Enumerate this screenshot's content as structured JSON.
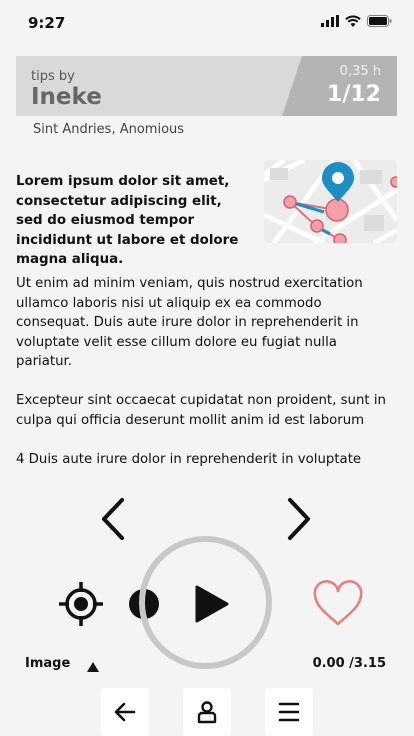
{
  "status_bar": {
    "time": "9:27"
  },
  "header": {
    "tips_by": "tips by",
    "guide_name": "Ineke",
    "duration": "0,35 h",
    "counter": "1/12"
  },
  "location": "Sint Andries, Anomious",
  "content": {
    "intro": "Lorem ipsum dolor sit amet, consectetur adipiscing elit, sed do eiusmod tempor incididunt ut labore et dolore magna aliqua.",
    "paragraphs": [
      "Ut enim ad minim veniam,  quis nostrud exercitation ullamco laboris nisi ut aliquip ex ea commodo consequat. Duis aute irure dolor in reprehenderit in voluptate velit esse cillum dolore eu fugiat nulla pariatur.",
      "Excepteur sint occaecat cupidatat non proident, sunt in culpa qui officia deserunt mollit anim id est laborum",
      "4 Duis aute irure dolor in reprehenderit in voluptate"
    ]
  },
  "player": {
    "image_label": "Image",
    "time": "0.00 /3.15"
  },
  "icons": {
    "prev": "chevron-left-icon",
    "next": "chevron-right-icon",
    "play": "play-icon",
    "locate": "crosshair-icon",
    "favorite": "heart-icon",
    "back": "arrow-left-icon",
    "profile": "person-icon",
    "menu": "hamburger-icon"
  },
  "colors": {
    "accent_pin": "#1c8ec2",
    "heart": "#f07a7a",
    "header_bg": "#d9d9d9",
    "header_dark": "#b4b4b4"
  }
}
